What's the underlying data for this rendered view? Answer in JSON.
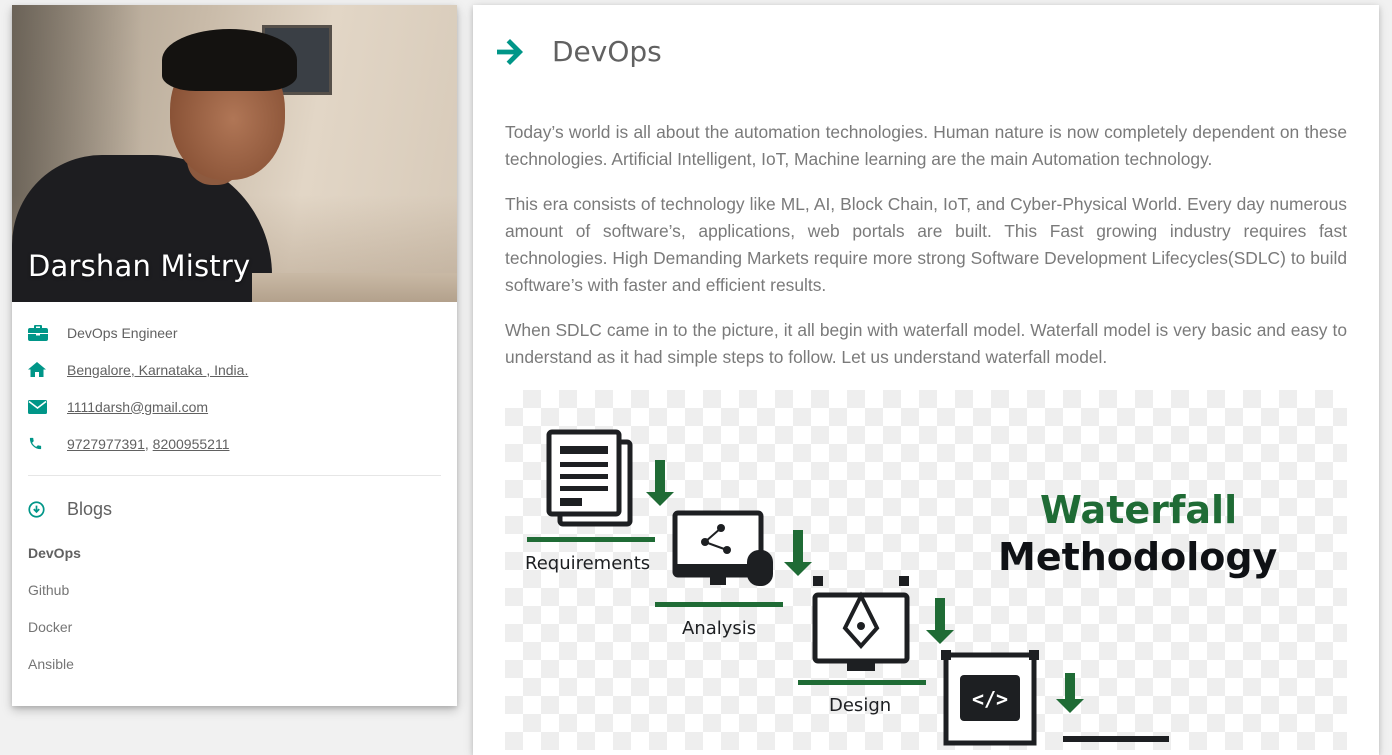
{
  "profile": {
    "name": "Darshan Mistry",
    "job": "DevOps Engineer",
    "location": "Bengalore, Karnataka , India.",
    "email": "1111darsh@gmail.com",
    "phone_1": "9727977391",
    "phone_sep": ", ",
    "phone_2": "8200955211"
  },
  "blogs": {
    "heading": "Blogs",
    "items": [
      "DevOps",
      "Github",
      "Docker",
      "Ansible"
    ],
    "active": "DevOps"
  },
  "article": {
    "title": "DevOps",
    "paragraphs": [
      "Today’s world is all about the automation technologies. Human nature is now completely dependent on these technologies. Artificial Intelligent, IoT, Machine learning are the main Automation technology.",
      "This era consists of technology like ML, AI, Block Chain, IoT, and Cyber-Physical World. Every day numerous amount of software’s, applications, web portals are built. This Fast growing industry requires fast technologies. High Demanding Markets require more strong Software Development Lifecycles(SDLC) to build software’s with faster and efficient results.",
      "When SDLC came in to the picture, it all begin with waterfall model. Waterfall model is very basic and easy to understand as it had simple steps to follow. Let us understand waterfall model."
    ]
  },
  "figure": {
    "title_line1": "Waterfall",
    "title_line2": "Methodology",
    "steps": [
      "Requirements",
      "Analysis",
      "Design"
    ]
  },
  "colors": {
    "accent": "#009688",
    "figure_green": "#1f6b35",
    "figure_dark": "#1d1f22"
  },
  "icons": {
    "job": "briefcase-icon",
    "location": "home-icon",
    "email": "envelope-icon",
    "phone": "phone-icon",
    "blogs": "circle-arrow-down-icon",
    "title": "arrow-right-icon"
  }
}
